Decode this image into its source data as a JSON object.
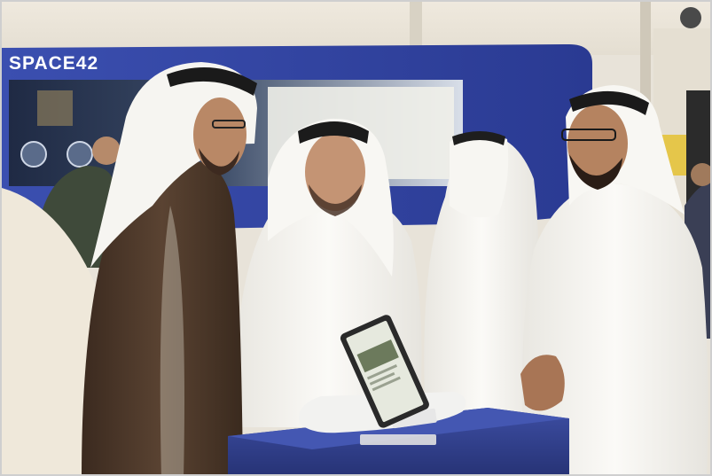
{
  "photo": {
    "banner_text": "SPACE42"
  },
  "colors": {
    "banner_blue": "#2e3f9a",
    "ceiling": "#ece7dd",
    "thobe_white": "#f5f4f0",
    "bisht_brown": "#4a3526",
    "podium_blue": "#2d3b86",
    "tablet_frame": "#2a2a2a",
    "tablet_screen": "#e4e7dc"
  }
}
